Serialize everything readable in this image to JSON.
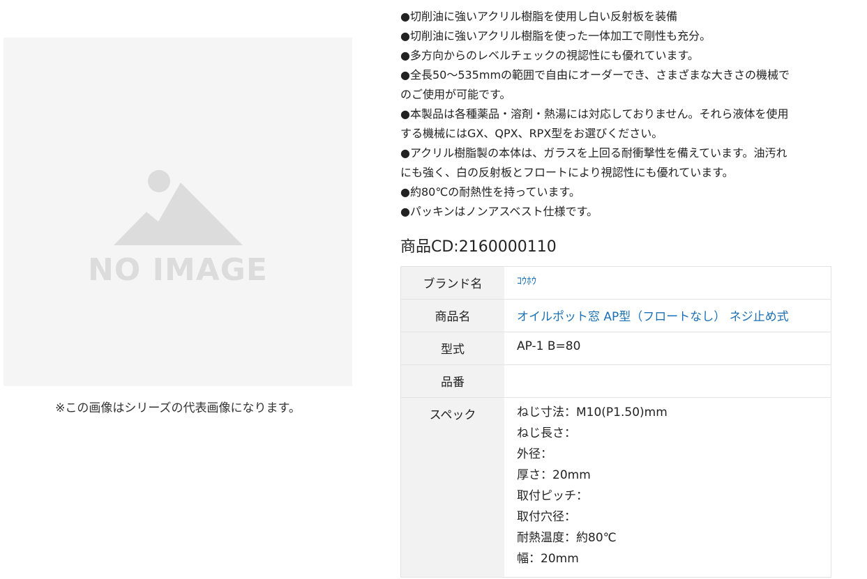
{
  "image": {
    "placeholder_text": "NO IMAGE",
    "caption": "※この画像はシリーズの代表画像になります。"
  },
  "features": [
    "●切削油に強いアクリル樹脂を使用し白い反射板を装備",
    "●切削油に強いアクリル樹脂を使った一体加工で剛性も充分。",
    "●多方向からのレベルチェックの視認性にも優れています。",
    "●全長50～535mmの範囲で自由にオーダーでき、さまざまな大きさの機械で",
    "のご使用が可能です。",
    "●本製品は各種薬品・溶剤・熱湯には対応しておりません。それら液体を使用",
    "する機械にはGX、QPX、RPX型をお選びください。",
    "●アクリル樹脂製の本体は、ガラスを上回る耐衝撃性を備えています。油汚れ",
    "にも強く、白の反射板とフロートにより視認性にも優れています。",
    "●約80℃の耐熱性を持っています。",
    "●パッキンはノンアスベスト仕様です。"
  ],
  "product_code": "商品CD:2160000110",
  "table": {
    "brand": {
      "label": "ブランド名",
      "value": "ｺｳﾎｳ"
    },
    "product_name": {
      "label": "商品名",
      "value": "オイルポット窓 AP型（フロートなし） ネジ止め式"
    },
    "model": {
      "label": "型式",
      "value": "AP-1 B=80"
    },
    "part_number": {
      "label": "品番",
      "value": ""
    },
    "spec": {
      "label": "スペック",
      "lines": [
        "ねじ寸法：M10(P1.50)mm",
        "ねじ長さ：",
        "外径：",
        "厚さ：20mm",
        "取付ピッチ：",
        "取付穴径：",
        "耐熱温度：約80℃",
        "幅：20mm"
      ]
    }
  },
  "colors": {
    "link": "#1a6fb5",
    "header_bg": "#f2f2f2",
    "placeholder_bg": "#f5f5f5",
    "placeholder_fg": "#dcdcdc"
  }
}
